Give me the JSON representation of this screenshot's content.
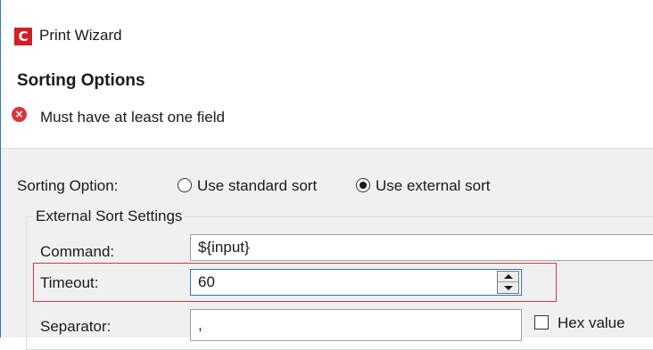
{
  "window": {
    "app_icon_letter": "C",
    "title": "Print Wizard"
  },
  "header": {
    "title": "Sorting Options",
    "error_message": "Must have at least one field",
    "error_icon": "error-circle-icon"
  },
  "sorting": {
    "label": "Sorting Option:",
    "options": [
      {
        "label": "Use standard sort",
        "selected": false
      },
      {
        "label": "Use external sort",
        "selected": true
      }
    ]
  },
  "external_sort": {
    "group_label": "External Sort Settings",
    "command": {
      "label": "Command:",
      "value": "${input}"
    },
    "timeout": {
      "label": "Timeout:",
      "value": "60"
    },
    "separator": {
      "label": "Separator:",
      "value": ","
    },
    "hex_value": {
      "label": "Hex value",
      "checked": false
    }
  },
  "colors": {
    "accent": "#2b78d0",
    "brand_red": "#d31f26",
    "error_red": "#d9363e",
    "panel_bg": "#f0f0f0"
  }
}
